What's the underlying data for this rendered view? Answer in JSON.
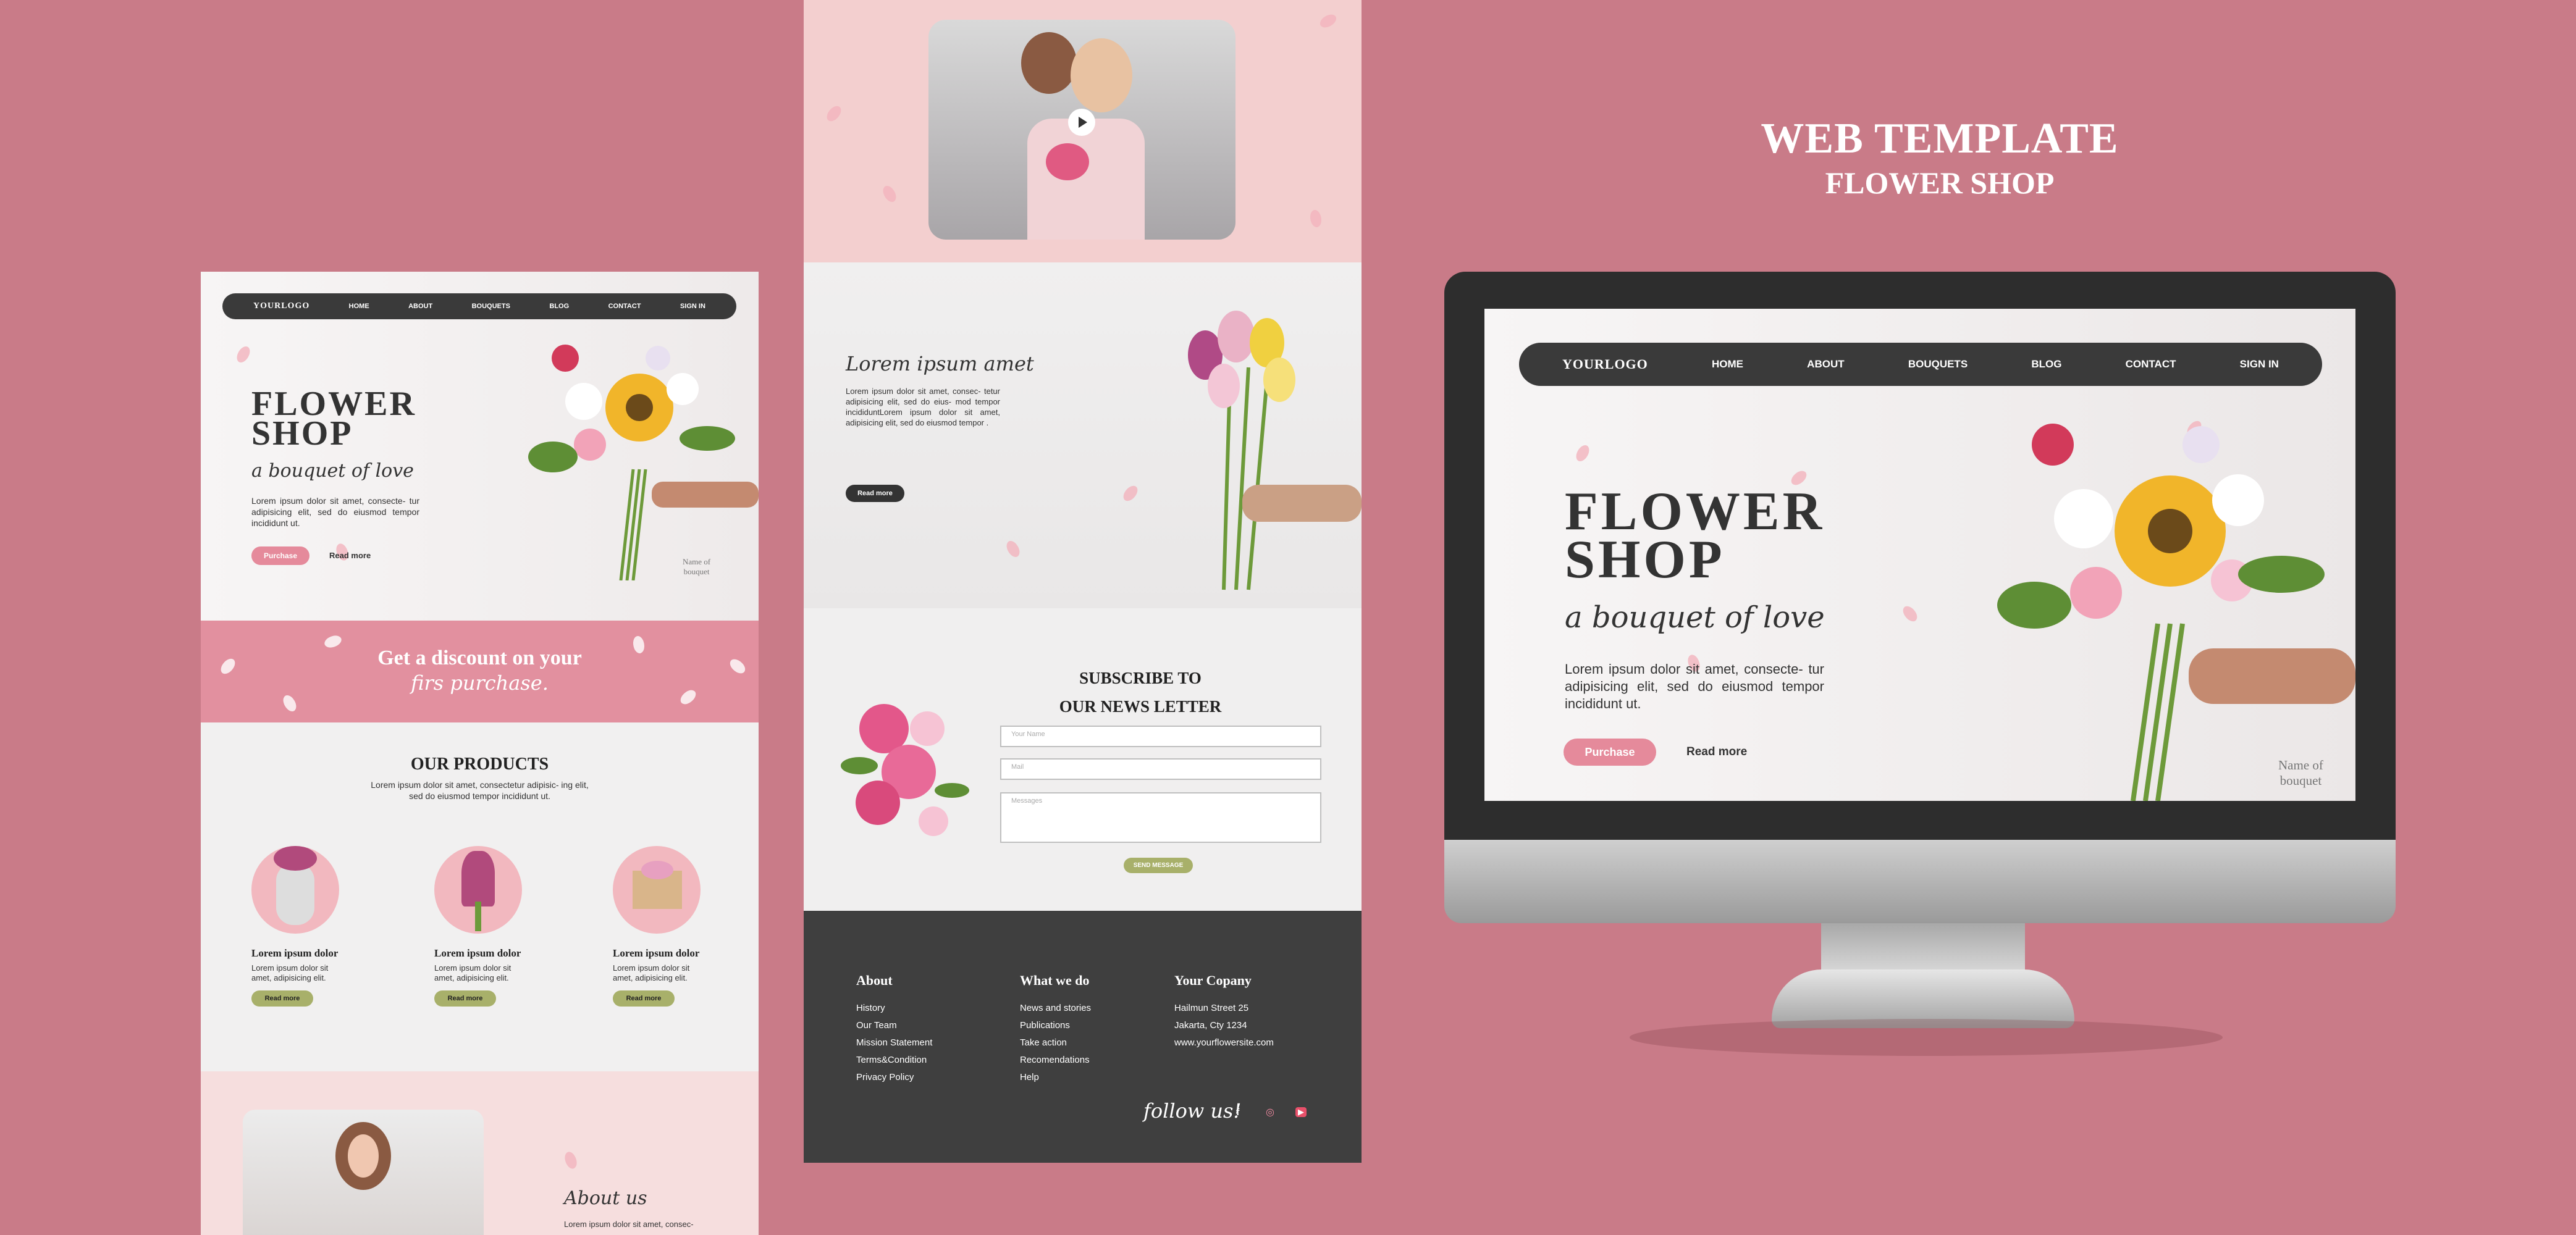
{
  "heading": {
    "title": "WEB TEMPLATE",
    "subtitle": "FLOWER SHOP"
  },
  "nav": {
    "logo": "YOURLOGO",
    "items": [
      "HOME",
      "ABOUT",
      "BOUQUETS",
      "BLOG",
      "CONTACT"
    ],
    "signin": "SIGN IN"
  },
  "hero": {
    "title1": "FLOWER",
    "title2": "SHOP",
    "tagline": "a bouquet of love",
    "desc_left": "Lorem ipsum dolor sit amet, consecte- tur adipisicing elit, sed do eiusmod tempor incididunt ut.",
    "desc_monitor": "Lorem ipsum dolor sit amet, consecte- tur adipisicing elit, sed do eiusmod tempor incididunt ut.",
    "purchase": "Purchase",
    "readmore": "Read more",
    "name_of": "Name of",
    "bouquet": "bouquet"
  },
  "discount": {
    "line1": "Get a discount on your",
    "line2": "firs purchase."
  },
  "products": {
    "title": "OUR PRODUCTS",
    "desc": "Lorem ipsum dolor sit amet, consectetur adipisic- ing elit, sed do eiusmod tempor incididunt ut.",
    "items": [
      {
        "name": "Lorem ipsum dolor",
        "desc": "Lorem ipsum dolor sit amet, adipisicing elit.",
        "btn": "Read more"
      },
      {
        "name": "Lorem ipsum dolor",
        "desc": "Lorem ipsum dolor sit amet, adipisicing elit.",
        "btn": "Read more"
      },
      {
        "name": "Lorem ipsum dolor",
        "desc": "Lorem ipsum dolor sit amet, adipisicing elit.",
        "btn": "Read more"
      }
    ]
  },
  "about": {
    "title": "About us",
    "desc": "Lorem ipsum dolor sit amet, consec-"
  },
  "middle": {
    "lorem_title": "Lorem ipsum amet",
    "lorem_desc": "Lorem ipsum dolor sit amet, consec- tetur adipisicing elit, sed do eius- mod tempor incididuntLorem ipsum dolor sit amet, adipisicing elit, sed do eiusmod tempor .",
    "readmore": "Read more"
  },
  "newsletter": {
    "title1": "SUBSCRIBE TO",
    "title2": "OUR NEWS LETTER",
    "name_ph": "Your Name",
    "mail_ph": "Mail",
    "msg_ph": "Messages",
    "send": "SEND MESSAGE"
  },
  "footer": {
    "about_title": "About",
    "about_links": [
      "History",
      "Our Team",
      "Mission Statement",
      "Terms&Condition",
      "Privacy Policy"
    ],
    "what_title": "What we do",
    "what_links": [
      "News and stories",
      "Publications",
      "Take action",
      "Recomendations",
      "Help"
    ],
    "company_title": "Your Copany",
    "company_lines": [
      "Hailmun Street 25",
      "Jakarta, Cty 1234",
      "www.yourflowersite.com"
    ],
    "follow": "follow us!",
    "social": [
      "f",
      "◎",
      "▶"
    ]
  },
  "colors": {
    "background": "#c97b88",
    "pink": "#e58a9b",
    "dark": "#3a3a3a",
    "green": "#a8b06a"
  }
}
